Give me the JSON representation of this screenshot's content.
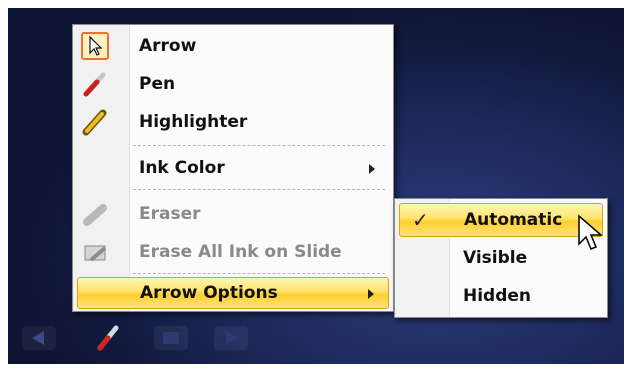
{
  "context_menu": {
    "items": [
      {
        "label": "Arrow",
        "icon": "arrow-cursor-icon",
        "selected": true
      },
      {
        "label": "Pen",
        "icon": "pen-icon"
      },
      {
        "label": "Highlighter",
        "icon": "highlighter-icon"
      },
      {
        "label": "Ink Color",
        "submenu": true
      },
      {
        "label": "Eraser",
        "icon": "eraser-icon",
        "disabled": true
      },
      {
        "label": "Erase All Ink on Slide",
        "icon": "erase-all-icon",
        "disabled": true
      },
      {
        "label": "Arrow Options",
        "submenu": true,
        "highlighted": true
      }
    ]
  },
  "arrow_options_submenu": {
    "items": [
      {
        "label": "Automatic",
        "checked": true,
        "highlighted": true
      },
      {
        "label": "Visible"
      },
      {
        "label": "Hidden"
      }
    ]
  },
  "toolbar": {
    "buttons": [
      "previous-slide-icon",
      "pen-icon",
      "menu-icon",
      "next-slide-icon"
    ]
  },
  "colors": {
    "highlight": "#ffd84a",
    "highlight_border": "#d9a21a",
    "selected_icon_border": "#e8742a",
    "background": "#1f2c61"
  }
}
